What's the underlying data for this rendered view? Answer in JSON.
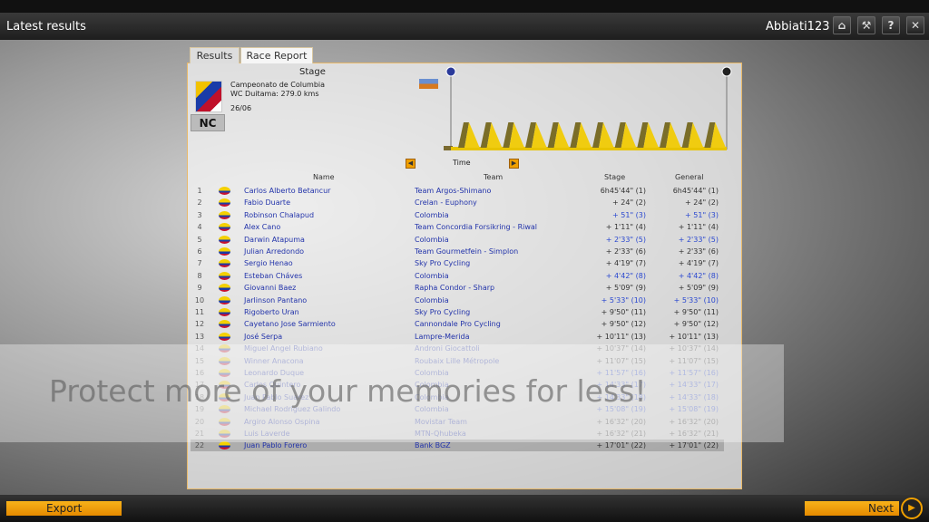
{
  "window": {
    "title": "Latest results",
    "user": "Abbiati123",
    "icons": [
      "home-icon",
      "wrench-icon",
      "help-icon",
      "close-icon"
    ],
    "icon_glyphs": [
      "⌂",
      "🔧",
      "?",
      "✕"
    ]
  },
  "tabs": [
    {
      "label": "Results"
    },
    {
      "label": "Race Report",
      "active": true
    }
  ],
  "stage": {
    "heading": "Stage",
    "race": "Campeonato de Columbia",
    "route": "WC Duitama: 279.0 kms",
    "date": "26/06",
    "badge": "NC",
    "climbs": 12
  },
  "sort": {
    "label": "Time"
  },
  "columns": {
    "name": "Name",
    "team": "Team",
    "stage": "Stage",
    "general": "General"
  },
  "rows": [
    {
      "rank": "1",
      "name": "Carlos Alberto Betancur",
      "team": "Team Argos-Shimano",
      "stage": "6h45'44\" (1)",
      "general": "6h45'44\" (1)"
    },
    {
      "rank": "2",
      "name": "Fabio Duarte",
      "team": "Crelan - Euphony",
      "stage": "+ 24\" (2)",
      "general": "+ 24\" (2)"
    },
    {
      "rank": "3",
      "name": "Robinson Chalapud",
      "team": "Colombia",
      "stage": "+ 51\" (3)",
      "general": "+ 51\" (3)",
      "blue": true
    },
    {
      "rank": "4",
      "name": "Alex Cano",
      "team": "Team Concordia Forsikring - Riwal",
      "stage": "+ 1'11\" (4)",
      "general": "+ 1'11\" (4)"
    },
    {
      "rank": "5",
      "name": "Darwin Atapuma",
      "team": "Colombia",
      "stage": "+ 2'33\" (5)",
      "general": "+ 2'33\" (5)",
      "blue": true
    },
    {
      "rank": "6",
      "name": "Julian Arredondo",
      "team": "Team Gourmetfein - Simplon",
      "stage": "+ 2'33\" (6)",
      "general": "+ 2'33\" (6)"
    },
    {
      "rank": "7",
      "name": "Sergio Henao",
      "team": "Sky Pro Cycling",
      "stage": "+ 4'19\" (7)",
      "general": "+ 4'19\" (7)"
    },
    {
      "rank": "8",
      "name": "Esteban Cháves",
      "team": "Colombia",
      "stage": "+ 4'42\" (8)",
      "general": "+ 4'42\" (8)",
      "blue": true
    },
    {
      "rank": "9",
      "name": "Giovanni Baez",
      "team": "Rapha Condor - Sharp",
      "stage": "+ 5'09\" (9)",
      "general": "+ 5'09\" (9)"
    },
    {
      "rank": "10",
      "name": "Jarlinson Pantano",
      "team": "Colombia",
      "stage": "+ 5'33\" (10)",
      "general": "+ 5'33\" (10)",
      "blue": true
    },
    {
      "rank": "11",
      "name": "Rigoberto Uran",
      "team": "Sky Pro Cycling",
      "stage": "+ 9'50\" (11)",
      "general": "+ 9'50\" (11)"
    },
    {
      "rank": "12",
      "name": "Cayetano Jose Sarmiento",
      "team": "Cannondale Pro Cycling",
      "stage": "+ 9'50\" (12)",
      "general": "+ 9'50\" (12)"
    },
    {
      "rank": "13",
      "name": "José Serpa",
      "team": "Lampre-Merida",
      "stage": "+ 10'11\" (13)",
      "general": "+ 10'11\" (13)"
    },
    {
      "rank": "14",
      "name": "Miguel Angel Rubiano",
      "team": "Androni Giocattoli",
      "stage": "+ 10'37\" (14)",
      "general": "+ 10'37\" (14)"
    },
    {
      "rank": "15",
      "name": "Winner Anacona",
      "team": "Roubaix Lille Métropole",
      "stage": "+ 11'07\" (15)",
      "general": "+ 11'07\" (15)"
    },
    {
      "rank": "16",
      "name": "Leonardo Duque",
      "team": "Colombia",
      "stage": "+ 11'57\" (16)",
      "general": "+ 11'57\" (16)",
      "blue": true
    },
    {
      "rank": "17",
      "name": "Carlos Quintero",
      "team": "Colombia",
      "stage": "+ 14'33\" (17)",
      "general": "+ 14'33\" (17)",
      "blue": true
    },
    {
      "rank": "18",
      "name": "Juan Pablo Suarez",
      "team": "Colombia",
      "stage": "+ 14'33\" (18)",
      "general": "+ 14'33\" (18)",
      "blue": true
    },
    {
      "rank": "19",
      "name": "Michael Rodriguez Galindo",
      "team": "Colombia",
      "stage": "+ 15'08\" (19)",
      "general": "+ 15'08\" (19)",
      "blue": true
    },
    {
      "rank": "20",
      "name": "Argiro Alonso Ospina",
      "team": "Movistar Team",
      "stage": "+ 16'32\" (20)",
      "general": "+ 16'32\" (20)"
    },
    {
      "rank": "21",
      "name": "Luis Laverde",
      "team": "MTN-Qhubeka",
      "stage": "+ 16'32\" (21)",
      "general": "+ 16'32\" (21)"
    },
    {
      "rank": "22",
      "name": "Juan Pablo Forero",
      "team": "Bank BGZ",
      "stage": "+ 17'01\" (22)",
      "general": "+ 17'01\" (22)",
      "highlight": true
    }
  ],
  "watermark": "Protect more of your memories for less!",
  "footer": {
    "export": "Export",
    "next": "Next"
  },
  "colors": {
    "accent": "#f0a000",
    "link": "#2233aa",
    "highlight_time": "#2a48d0"
  }
}
